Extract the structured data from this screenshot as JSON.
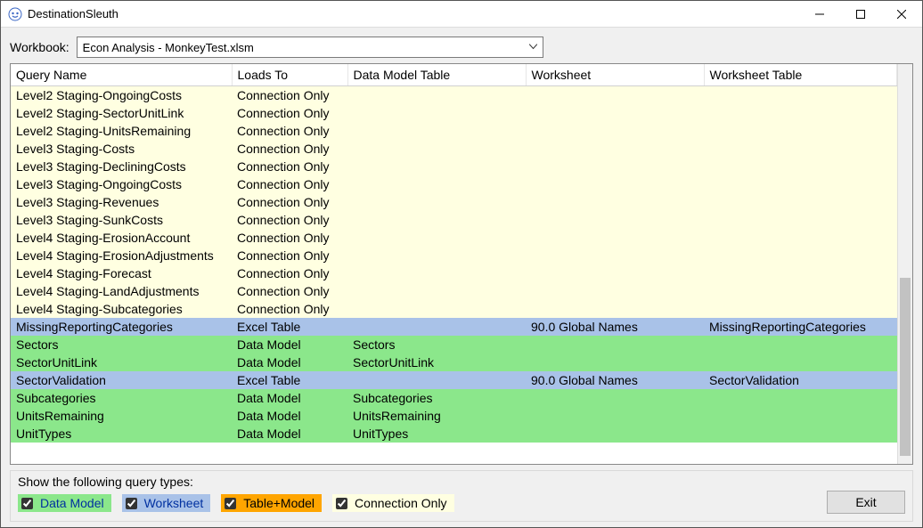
{
  "window": {
    "title": "DestinationSleuth"
  },
  "workbook": {
    "label": "Workbook:",
    "selected": "Econ Analysis - MonkeyTest.xlsm"
  },
  "columns": {
    "query_name": "Query Name",
    "loads_to": "Loads To",
    "data_model_table": "Data Model Table",
    "worksheet": "Worksheet",
    "worksheet_table": "Worksheet Table"
  },
  "rows": [
    {
      "kind": "conn",
      "query_name": "Level2 Staging-OngoingCosts",
      "loads_to": "Connection Only",
      "data_model_table": "",
      "worksheet": "",
      "worksheet_table": ""
    },
    {
      "kind": "conn",
      "query_name": "Level2 Staging-SectorUnitLink",
      "loads_to": "Connection Only",
      "data_model_table": "",
      "worksheet": "",
      "worksheet_table": ""
    },
    {
      "kind": "conn",
      "query_name": "Level2 Staging-UnitsRemaining",
      "loads_to": "Connection Only",
      "data_model_table": "",
      "worksheet": "",
      "worksheet_table": ""
    },
    {
      "kind": "conn",
      "query_name": "Level3 Staging-Costs",
      "loads_to": "Connection Only",
      "data_model_table": "",
      "worksheet": "",
      "worksheet_table": ""
    },
    {
      "kind": "conn",
      "query_name": "Level3 Staging-DecliningCosts",
      "loads_to": "Connection Only",
      "data_model_table": "",
      "worksheet": "",
      "worksheet_table": ""
    },
    {
      "kind": "conn",
      "query_name": "Level3 Staging-OngoingCosts",
      "loads_to": "Connection Only",
      "data_model_table": "",
      "worksheet": "",
      "worksheet_table": ""
    },
    {
      "kind": "conn",
      "query_name": "Level3 Staging-Revenues",
      "loads_to": "Connection Only",
      "data_model_table": "",
      "worksheet": "",
      "worksheet_table": ""
    },
    {
      "kind": "conn",
      "query_name": "Level3 Staging-SunkCosts",
      "loads_to": "Connection Only",
      "data_model_table": "",
      "worksheet": "",
      "worksheet_table": ""
    },
    {
      "kind": "conn",
      "query_name": "Level4 Staging-ErosionAccount",
      "loads_to": "Connection Only",
      "data_model_table": "",
      "worksheet": "",
      "worksheet_table": ""
    },
    {
      "kind": "conn",
      "query_name": "Level4 Staging-ErosionAdjustments",
      "loads_to": "Connection Only",
      "data_model_table": "",
      "worksheet": "",
      "worksheet_table": ""
    },
    {
      "kind": "conn",
      "query_name": "Level4 Staging-Forecast",
      "loads_to": "Connection Only",
      "data_model_table": "",
      "worksheet": "",
      "worksheet_table": ""
    },
    {
      "kind": "conn",
      "query_name": "Level4 Staging-LandAdjustments",
      "loads_to": "Connection Only",
      "data_model_table": "",
      "worksheet": "",
      "worksheet_table": ""
    },
    {
      "kind": "conn",
      "query_name": "Level4 Staging-Subcategories",
      "loads_to": "Connection Only",
      "data_model_table": "",
      "worksheet": "",
      "worksheet_table": ""
    },
    {
      "kind": "blue",
      "query_name": "MissingReportingCategories",
      "loads_to": "Excel Table",
      "data_model_table": "",
      "worksheet": "90.0 Global Names",
      "worksheet_table": "MissingReportingCategories"
    },
    {
      "kind": "green",
      "query_name": "Sectors",
      "loads_to": "Data Model",
      "data_model_table": "Sectors",
      "worksheet": "",
      "worksheet_table": ""
    },
    {
      "kind": "green",
      "query_name": "SectorUnitLink",
      "loads_to": "Data Model",
      "data_model_table": "SectorUnitLink",
      "worksheet": "",
      "worksheet_table": ""
    },
    {
      "kind": "blue",
      "query_name": "SectorValidation",
      "loads_to": "Excel Table",
      "data_model_table": "",
      "worksheet": "90.0 Global Names",
      "worksheet_table": "SectorValidation"
    },
    {
      "kind": "green",
      "query_name": "Subcategories",
      "loads_to": "Data Model",
      "data_model_table": "Subcategories",
      "worksheet": "",
      "worksheet_table": ""
    },
    {
      "kind": "green",
      "query_name": "UnitsRemaining",
      "loads_to": "Data Model",
      "data_model_table": "UnitsRemaining",
      "worksheet": "",
      "worksheet_table": ""
    },
    {
      "kind": "green",
      "query_name": "UnitTypes",
      "loads_to": "Data Model",
      "data_model_table": "UnitTypes",
      "worksheet": "",
      "worksheet_table": ""
    }
  ],
  "filters": {
    "legend": "Show the following query types:",
    "data_model": "Data Model",
    "worksheet": "Worksheet",
    "table_model": "Table+Model",
    "connection_only": "Connection Only"
  },
  "buttons": {
    "exit": "Exit"
  }
}
